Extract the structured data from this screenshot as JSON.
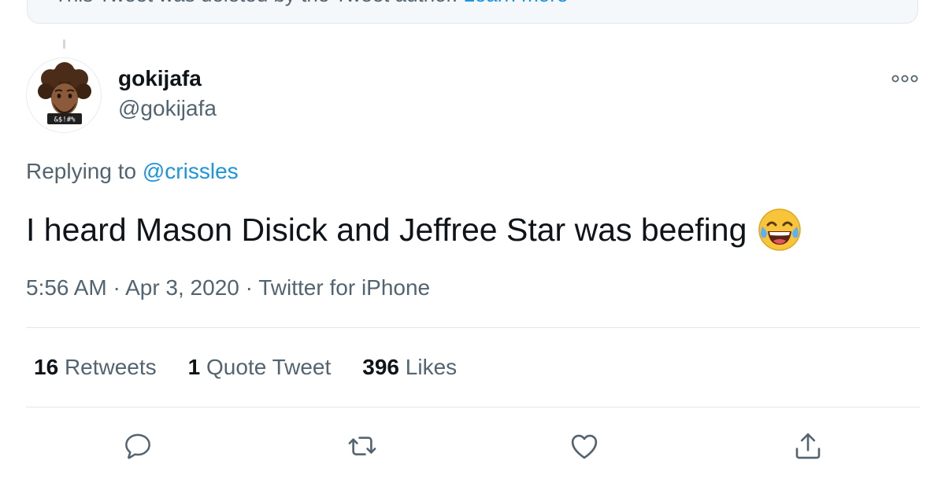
{
  "deleted_notice": {
    "text": "This Tweet was deleted by the Tweet author.",
    "link": "Learn more"
  },
  "author": {
    "display_name": "gokijafa",
    "handle": "@gokijafa",
    "avatar_badge": "&$!#%"
  },
  "reply": {
    "prefix": "Replying to",
    "mention": "@crissles"
  },
  "tweet": {
    "text": "I heard Mason Disick and Jeffree Star was beefing",
    "emoji": "face-with-tears-of-joy"
  },
  "meta": {
    "time": "5:56 AM",
    "separator": "·",
    "date": "Apr 3, 2020",
    "source": "Twitter for iPhone"
  },
  "stats": {
    "retweets_count": "16",
    "retweets_label": "Retweets",
    "quotes_count": "1",
    "quotes_label": "Quote Tweet",
    "likes_count": "396",
    "likes_label": "Likes"
  },
  "actions": {
    "reply_icon": "reply-icon",
    "retweet_icon": "retweet-icon",
    "like_icon": "heart-icon",
    "share_icon": "share-icon"
  },
  "colors": {
    "link": "#1b95e0",
    "secondary_text": "#536471",
    "primary_text": "#0f1419",
    "divider": "#e1e8ed"
  }
}
